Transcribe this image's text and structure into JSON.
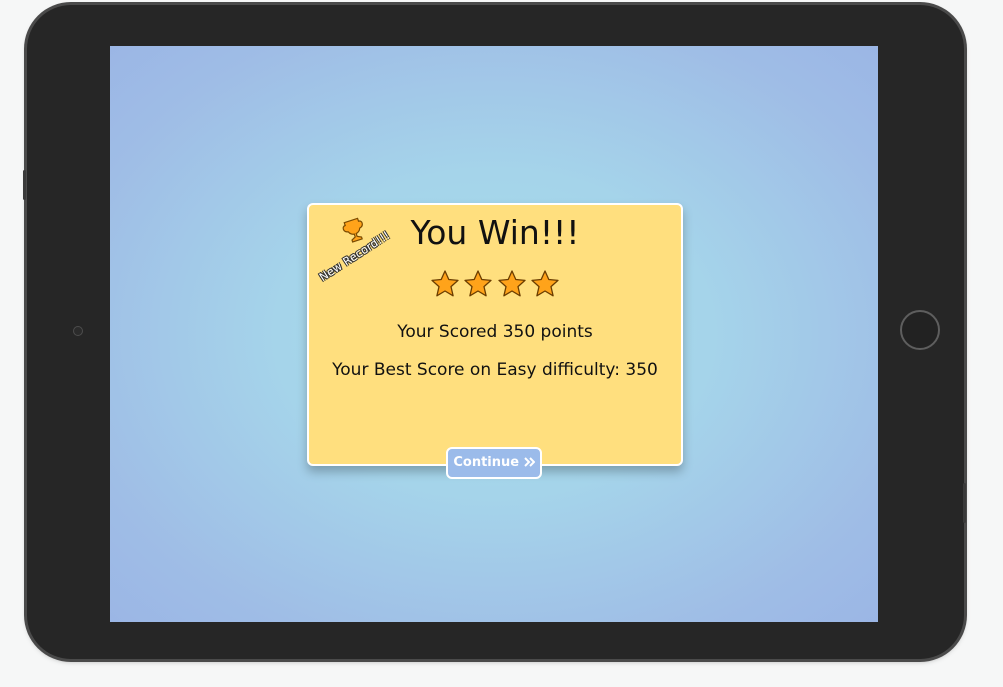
{
  "dialog": {
    "title": "You Win!!!",
    "record_badge": "New Record!!!",
    "stars_earned": 4,
    "score_line": "Your Scored 350 points",
    "best_score_line": "Your Best Score on Easy difficulty: 350",
    "continue_label": "Continue",
    "continue_icon": "double-chevron-right-icon"
  },
  "colors": {
    "dialog_background": "#ffdf7e",
    "star_fill": "#ffa31a",
    "continue_button": "#9bbbea",
    "screen_center": "#a6dde9",
    "screen_edge": "#9bb6e5",
    "tablet_frame": "#262626"
  }
}
